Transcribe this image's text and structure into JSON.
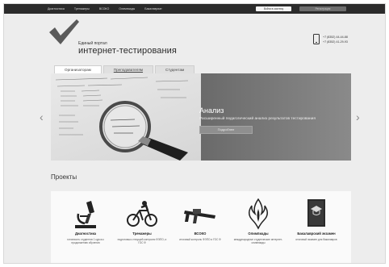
{
  "topbar": {
    "nav": [
      "Диагностика",
      "Тренажеры",
      "ВСОКО",
      "Олимпиады",
      "Бакалавриат"
    ],
    "login": "Войти в систему",
    "register": "Регистрация"
  },
  "header": {
    "brand_small": "Единый портал",
    "brand_big": "интернет-тестирования",
    "phones": [
      "+7 (8352) 44-44-88",
      "+7 (8352) 41-29-93"
    ]
  },
  "tabs": [
    "Организаторам",
    "Преподавателям",
    "Студентам"
  ],
  "slider": {
    "title": "Анализ",
    "description": "Расширенный педагогический анализ результатов тестирования",
    "button": "Подробнее",
    "prev": "‹",
    "next": "›"
  },
  "projects": {
    "title": "Проекты",
    "items": [
      {
        "name": "Диагностика",
        "desc": "готовность студентов 1 курса к продолжению обучения",
        "icon": "microscope-icon"
      },
      {
        "name": "Тренажеры",
        "desc": "подготовка к текущей контролю ФЭПО, и ГОС Ф",
        "icon": "bicycle-icon"
      },
      {
        "name": "ВСОКО",
        "desc": "итоговый контроль ФЭПО и ГОС Ф",
        "icon": "caliper-icon"
      },
      {
        "name": "Олимпиады",
        "desc": "международные студенческие интернет-олимпиады",
        "icon": "flame-icon"
      },
      {
        "name": "Бакалаврский экзамен",
        "desc": "итоговый экзамен для бакалавров",
        "icon": "book-icon"
      }
    ]
  },
  "colors": {
    "topbar": "#2b2b2b",
    "page": "#ededed",
    "slider": "#6b6b6b"
  }
}
